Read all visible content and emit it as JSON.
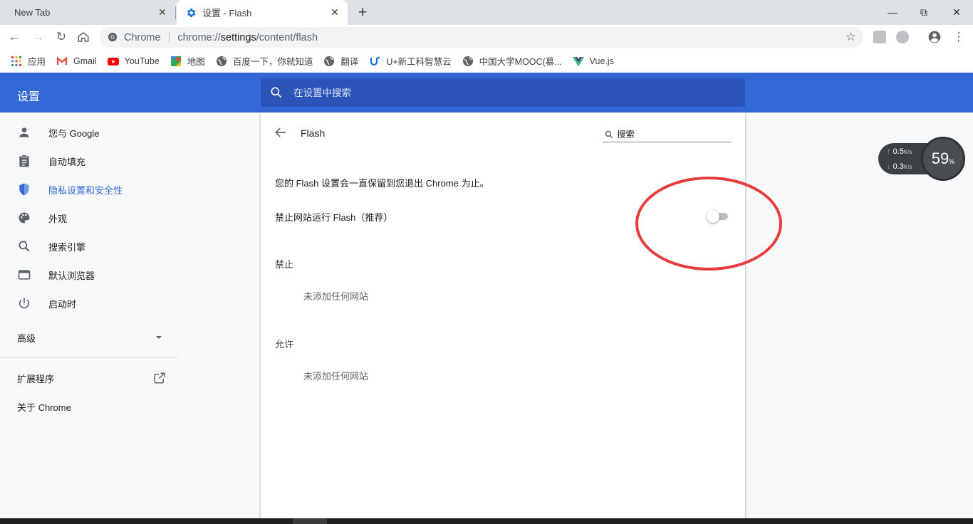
{
  "tabs": [
    {
      "title": "New Tab",
      "active": false
    },
    {
      "title": "设置 - Flash",
      "active": true,
      "icon": "gear-icon"
    }
  ],
  "window": {
    "new_tab_symbol": "+",
    "minimize_symbol": "—",
    "restore_symbol": "⧉",
    "close_symbol": "✕",
    "tab_close_symbol": "✕"
  },
  "toolbar": {
    "back_symbol": "←",
    "forward_symbol": "→",
    "reload_symbol": "↻",
    "omnibox_label": "Chrome",
    "omnibox_sep": "|",
    "url_prefix": "chrome://",
    "url_host": "settings",
    "url_path": "/content/flash",
    "star_symbol": "☆",
    "menu_symbol": "⋮"
  },
  "bookmarks": [
    {
      "label": "应用",
      "icon": "apps-grid-icon"
    },
    {
      "label": "Gmail",
      "icon": "gmail-icon"
    },
    {
      "label": "YouTube",
      "icon": "youtube-icon"
    },
    {
      "label": "地图",
      "icon": "maps-icon"
    },
    {
      "label": "百度一下，你就知道",
      "icon": "globe-icon"
    },
    {
      "label": "翻译",
      "icon": "globe-icon"
    },
    {
      "label": "U+新工科智慧云",
      "icon": "u-logo-icon"
    },
    {
      "label": "中国大学MOOC(慕...",
      "icon": "globe-icon"
    },
    {
      "label": "Vue.js",
      "icon": "vue-icon"
    }
  ],
  "settings": {
    "title": "设置",
    "search_placeholder": "在设置中搜索"
  },
  "sidebar": {
    "items": [
      {
        "label": "您与 Google",
        "icon": "person-icon",
        "active": false
      },
      {
        "label": "自动填充",
        "icon": "clipboard-icon",
        "active": false
      },
      {
        "label": "隐私设置和安全性",
        "icon": "shield-icon",
        "active": true
      },
      {
        "label": "外观",
        "icon": "palette-icon",
        "active": false
      },
      {
        "label": "搜索引擎",
        "icon": "search-icon",
        "active": false
      },
      {
        "label": "默认浏览器",
        "icon": "browser-icon",
        "active": false
      },
      {
        "label": "启动时",
        "icon": "power-icon",
        "active": false
      }
    ],
    "advanced": "高级",
    "extensions": "扩展程序",
    "about": "关于 Chrome"
  },
  "flash": {
    "title": "Flash",
    "search_placeholder": "搜索",
    "description": "您的 Flash 设置会一直保留到您退出 Chrome 为止。",
    "toggle_label": "禁止网站运行 Flash（推荐）",
    "toggle_on": false,
    "blocked_header": "禁止",
    "blocked_empty": "未添加任何网站",
    "allowed_header": "允许",
    "allowed_empty": "未添加任何网站"
  },
  "netwidget": {
    "up_value": "0.5",
    "up_unit": "K/s",
    "down_value": "0.3",
    "down_unit": "K/s",
    "gauge_value": "59",
    "gauge_unit": "%"
  },
  "colors": {
    "accent": "#3367d6",
    "annotation": "#e83b3b"
  }
}
